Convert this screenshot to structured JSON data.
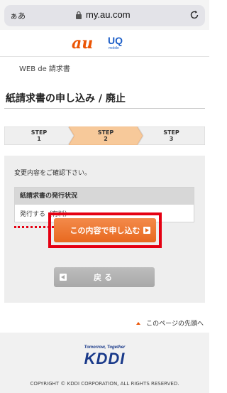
{
  "browser": {
    "text_size_label": "ぁあ",
    "url": "my.au.com"
  },
  "logos": {
    "au": "au",
    "uq": "UQ",
    "uq_sub": "mobile"
  },
  "breadcrumb": "WEB de 請求書",
  "page_title": "紙請求書の申し込み / 廃止",
  "steps": [
    {
      "label": "STEP",
      "num": "1",
      "active": false
    },
    {
      "label": "STEP",
      "num": "2",
      "active": true
    },
    {
      "label": "STEP",
      "num": "3",
      "active": false
    }
  ],
  "confirm_text": "変更内容をご確認下さい。",
  "status": {
    "heading": "紙請求書の発行状況",
    "value": "発行する（有料）"
  },
  "buttons": {
    "apply": "この内容で申し込む",
    "back": "戻る"
  },
  "to_top": "このページの先頭へ",
  "footer": {
    "tagline": "Tomorrow, Together",
    "brand": "KDDI",
    "copyright": "COPYRIGHT © KDDI CORPORATION, ALL RIGHTS RESERVED."
  },
  "colors": {
    "accent_orange": "#e8691f",
    "highlight_red": "#e50012",
    "step_active": "#f7c99a"
  }
}
